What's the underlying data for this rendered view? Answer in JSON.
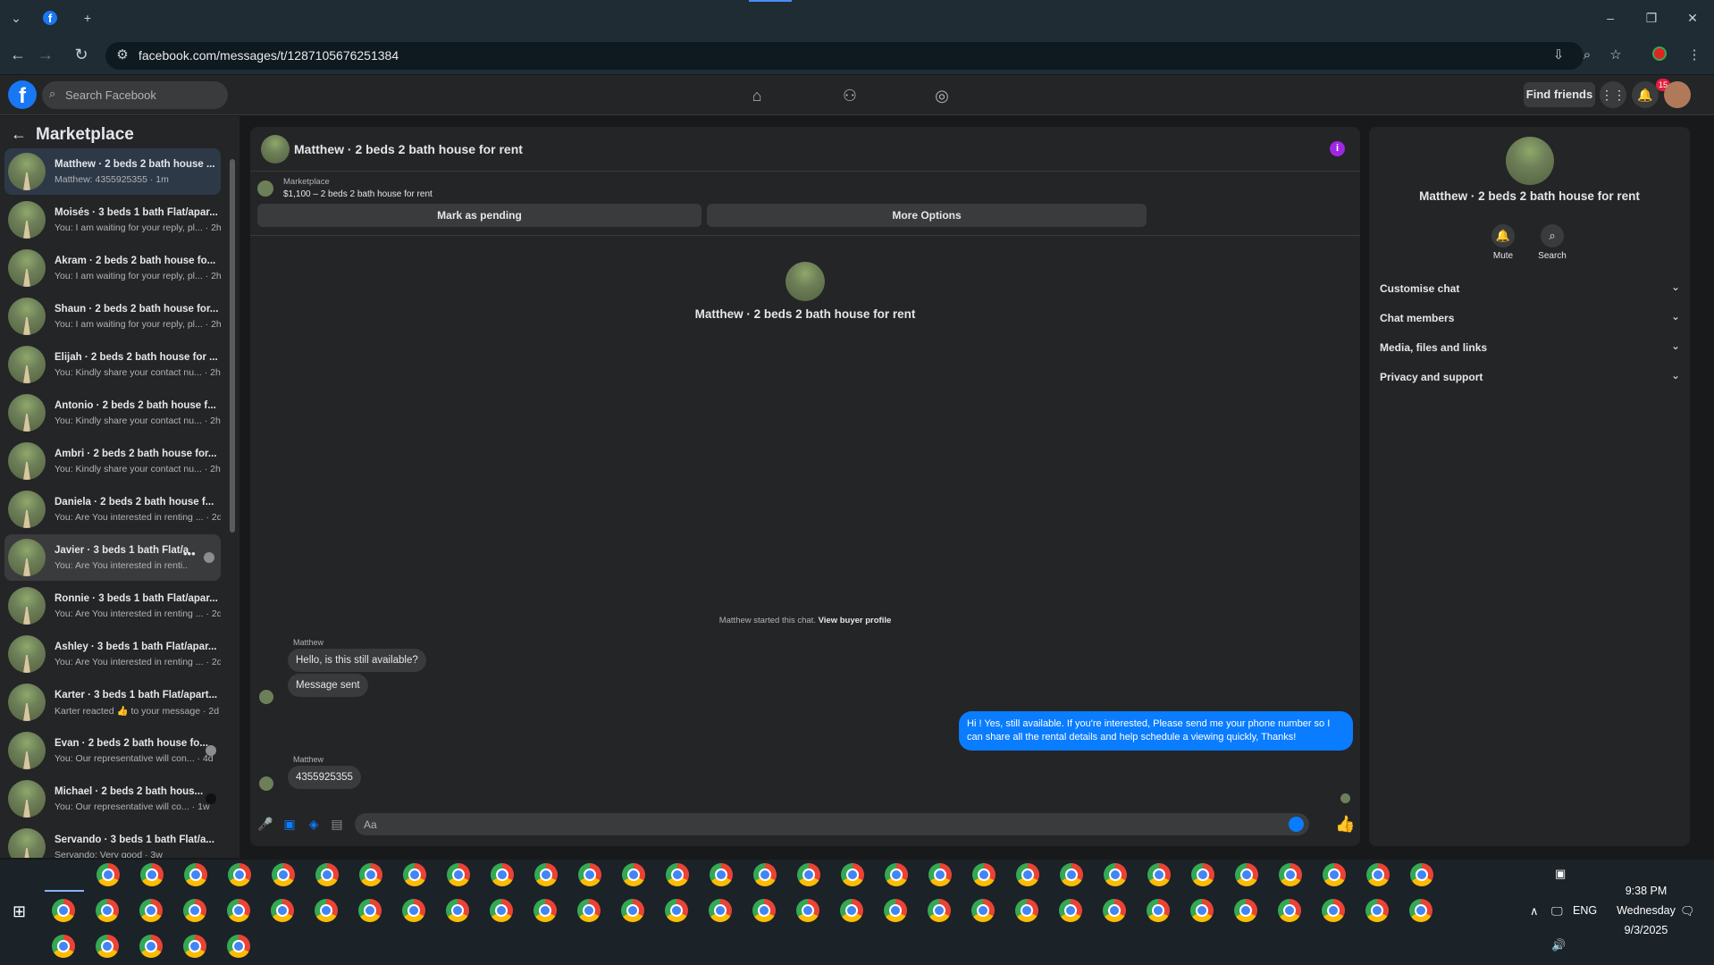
{
  "browser": {
    "url": "facebook.com/messages/t/1287105676251384"
  },
  "fb_header": {
    "search_placeholder": "Search Facebook",
    "find_friends": "Find friends",
    "notification_count": "15"
  },
  "sidebar": {
    "title": "Marketplace",
    "conversations": [
      {
        "name": "Matthew · 2 beds 2 bath house ...",
        "snippet": "Matthew: 4355925355 · 1m"
      },
      {
        "name": "Moisés · 3 beds 1 bath Flat/apar...",
        "snippet": "You: I am waiting for your reply, pl... · 2h"
      },
      {
        "name": "Akram · 2 beds 2 bath house fo...",
        "snippet": "You: I am waiting for your reply, pl... · 2h"
      },
      {
        "name": "Shaun · 2 beds 2 bath house for...",
        "snippet": "You: I am waiting for your reply, pl... · 2h"
      },
      {
        "name": "Elijah · 2 beds 2 bath house for ...",
        "snippet": "You: Kindly share your contact nu... · 2h"
      },
      {
        "name": "Antonio · 2 beds 2 bath house f...",
        "snippet": "You: Kindly share your contact nu... · 2h"
      },
      {
        "name": "Ambri · 2 beds 2 bath house for...",
        "snippet": "You: Kindly share your contact nu... · 2h"
      },
      {
        "name": "Daniela · 2 beds 2 bath house f...",
        "snippet": "You: Are You interested in renting ... · 2d"
      },
      {
        "name": "Javier · 3 beds 1 bath Flat/ar",
        "snippet": "You: Are You interested in renti... · 2d"
      },
      {
        "name": "Ronnie · 3 beds 1 bath Flat/apar...",
        "snippet": "You: Are You interested in renting ... · 2d"
      },
      {
        "name": "Ashley · 3 beds 1 bath Flat/apar...",
        "snippet": "You: Are You interested in renting ... · 2d"
      },
      {
        "name": "Karter · 3 beds 1 bath Flat/apart...",
        "snippet": "Karter reacted 👍 to your message · 2d"
      },
      {
        "name": "Evan · 2 beds 2 bath house fo...",
        "snippet": "You: Our representative will con... · 4d"
      },
      {
        "name": "Michael · 2 beds 2 bath hous...",
        "snippet": "You: Our representative will co... · 1w"
      },
      {
        "name": "Servando · 3 beds 1 bath Flat/a...",
        "snippet": "Servando: Very good · 3w"
      }
    ]
  },
  "chat": {
    "title": "Matthew · 2 beds 2 bath house for rent",
    "listing_source": "Marketplace",
    "listing_price": "$1,100 – 2 beds 2 bath house for rent",
    "mark_pending": "Mark as pending",
    "more_options": "More Options",
    "center_name": "Matthew · 2 beds 2 bath house for rent",
    "started_text": "Matthew started this chat.",
    "view_profile": "View buyer profile",
    "messages": [
      {
        "sender": "Matthew",
        "text": "Hello, is this still available?"
      },
      {
        "sender": "",
        "text": "Message sent"
      },
      {
        "sender": "You",
        "text": "Hi ! Yes, still available. If you're interested, Please send me your phone number so I can share all the rental details and help schedule a viewing quickly, Thanks!"
      },
      {
        "sender": "Matthew",
        "text": "4355925355"
      }
    ],
    "composer_placeholder": "Aa"
  },
  "right_panel": {
    "name": "Matthew · 2 beds 2 bath house for rent",
    "mute": "Mute",
    "search": "Search",
    "sections": [
      "Customise chat",
      "Chat members",
      "Media, files and links",
      "Privacy and support"
    ]
  },
  "taskbar": {
    "time": "9:38 PM",
    "day": "Wednesday",
    "date": "9/3/2025",
    "lang": "ENG"
  }
}
